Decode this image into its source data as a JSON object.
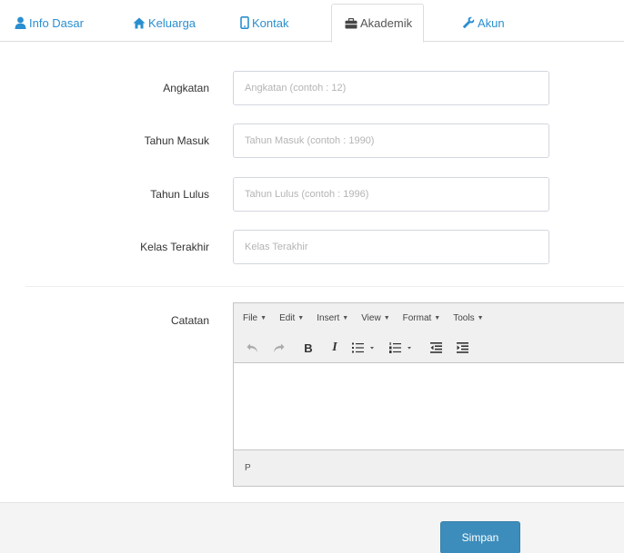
{
  "tabs": [
    {
      "label": "Info Dasar",
      "icon": "user-icon",
      "active": false
    },
    {
      "label": "Keluarga",
      "icon": "home-icon",
      "active": false
    },
    {
      "label": "Kontak",
      "icon": "mobile-icon",
      "active": false
    },
    {
      "label": "Akademik",
      "icon": "briefcase-icon",
      "active": true
    },
    {
      "label": "Akun",
      "icon": "wrench-icon",
      "active": false
    }
  ],
  "form": {
    "angkatan": {
      "label": "Angkatan",
      "placeholder": "Angkatan (contoh : 12)",
      "value": ""
    },
    "tahun_masuk": {
      "label": "Tahun Masuk",
      "placeholder": "Tahun Masuk (contoh : 1990)",
      "value": ""
    },
    "tahun_lulus": {
      "label": "Tahun Lulus",
      "placeholder": "Tahun Lulus (contoh : 1996)",
      "value": ""
    },
    "kelas_terakhir": {
      "label": "Kelas Terakhir",
      "placeholder": "Kelas Terakhir",
      "value": ""
    },
    "catatan": {
      "label": "Catatan"
    }
  },
  "editor": {
    "menus": [
      "File",
      "Edit",
      "Insert",
      "View",
      "Format",
      "Tools"
    ],
    "status_path": "P"
  },
  "footer": {
    "save_label": "Simpan"
  },
  "colors": {
    "link": "#2a8fcf",
    "primary_button": "#3c8dbc"
  }
}
